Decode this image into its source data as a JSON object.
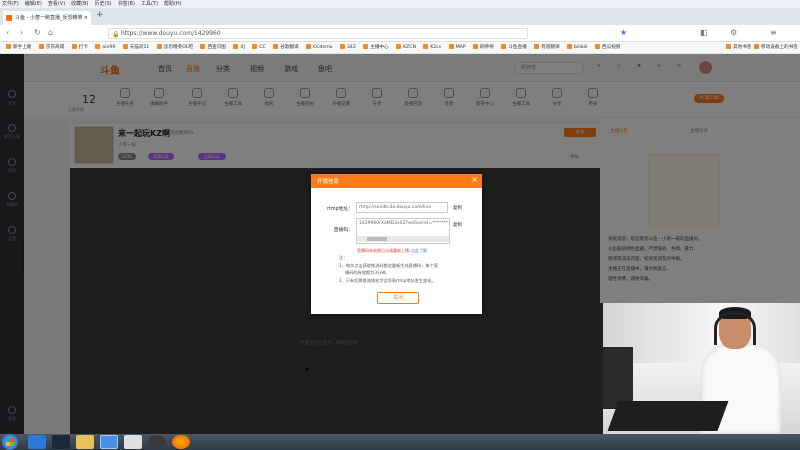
{
  "browser": {
    "menu": [
      "文件(F)",
      "编辑(E)",
      "查看(V)",
      "收藏(B)",
      "历史(S)",
      "书签(B)",
      "工具(T)",
      "帮助(H)"
    ],
    "tab_title": "斗鱼 - 小葱一碗直播_反恐精英",
    "url": "https://www.douyu.com/1429960",
    "bookmarks": [
      "新手上路",
      "京东商城",
      "打卡",
      "ain99",
      "天猫双11",
      "反恐精英OL吧",
      "西查识图",
      "XJ",
      "CC",
      "谷歌翻译",
      "CCdemo",
      "342",
      "主播中心",
      "KZCN",
      "K2cs",
      "MAP",
      "刷神榜",
      "斗鱼直播",
      "有道翻译",
      "bilibili",
      "西瓜视频"
    ],
    "bookmarks_right": [
      "其他书签",
      "移动设备上的书签"
    ]
  },
  "sidebar": {
    "items": [
      "关注",
      "推荐订阅",
      "游戏",
      "直播间",
      "设置"
    ],
    "bottom": "客服"
  },
  "site": {
    "logo": "斗鱼",
    "nav": [
      "首页",
      "直播",
      "分类",
      "视频",
      "游戏",
      "鱼吧"
    ],
    "search_placeholder": "刷神榜",
    "avatar_label": "头像"
  },
  "toolbar": {
    "level": "12",
    "level_sub": "主播等级",
    "items": [
      "主播任务",
      "弹幕助手",
      "主播手记",
      "主播工具",
      "福利",
      "主播装扮",
      "开播设置",
      "分享",
      "直播回放",
      "连麦",
      "超管中心",
      "主播工具",
      "分享",
      "更多"
    ],
    "pc_button": "PC客户端"
  },
  "room": {
    "title": "来一起玩KZ啊",
    "category": "反恐精英OL",
    "tags": [
      "小葱一碗",
      "LV30",
      "直播分享",
      "主播认证"
    ],
    "followers": "关注",
    "report": "举报",
    "hint": "主播正在准备中，请稍后观看"
  },
  "right_panel": {
    "tabs": [
      "主播公告",
      "主播分享"
    ],
    "chat": [
      "系统消息：欢迎来到斗鱼 - 小葱一碗的直播间，",
      "斗鱼鼓励绿色直播，严禁低俗、色情、暴力、",
      "赌博等违法内容，如发现请及时举报。",
      "主播正在直播中，请文明发言，",
      "理性消费，谨防诈骗。"
    ]
  },
  "modal": {
    "title": "开播信息",
    "rtmp_label": "rtmp地址：",
    "rtmp_value": "rtmp://sendtc3a.douyu.com/live",
    "code_label": "直播码：",
    "code_value": "1429960rXaMD3xXZ?wsSecret=*******",
    "copy_label": "复制",
    "warning": "直播码有效期已过请重新上播，",
    "warning_link": "点此了解",
    "notes_title": "注：",
    "notes": [
      "1、每次点击获取推流码都会重新生成直播码，每个直",
      "播码的有效期为3分钟。",
      "2、只有切换推流域名才会导致rtmp地址发生变化。"
    ],
    "close_button": "关闭"
  },
  "taskbar": {
    "apps": [
      "windows-start",
      "ie",
      "steam",
      "explorer",
      "teamviewer",
      "counter-strike",
      "obs",
      "firefox"
    ]
  },
  "colors": {
    "accent": "#ff7a1a",
    "warning": "#e03c3c",
    "link": "#3b7be0"
  }
}
